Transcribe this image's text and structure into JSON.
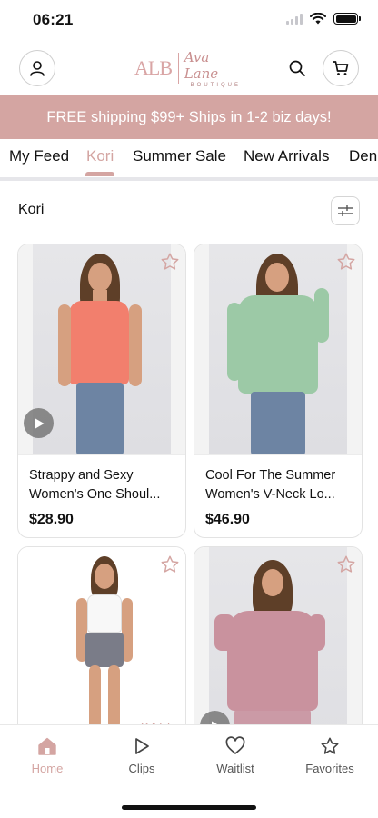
{
  "status_bar": {
    "time": "06:21"
  },
  "header": {
    "logo_monogram": "ALB",
    "logo_script": "Ava Lane",
    "logo_subtitle": "BOUTIQUE"
  },
  "banner": {
    "text": "FREE shipping $99+ Ships in 1-2 biz days!"
  },
  "tabs": [
    {
      "label": "My Feed",
      "active": false
    },
    {
      "label": "Kori",
      "active": true
    },
    {
      "label": "Summer Sale",
      "active": false
    },
    {
      "label": "New Arrivals",
      "active": false
    },
    {
      "label": "Den",
      "active": false
    }
  ],
  "section": {
    "title": "Kori"
  },
  "products": [
    {
      "title_line1": "Strappy and Sexy",
      "title_line2": "Women's One Shoul...",
      "price": "$28.90",
      "top_color": "#f27f6d",
      "has_video": true
    },
    {
      "title_line1": "Cool For The Summer",
      "title_line2": "Women's V-Neck Lo...",
      "price": "$46.90",
      "top_color": "#9cc9a6",
      "has_video": false
    },
    {
      "title_line1": "",
      "title_line2": "",
      "price": "",
      "top_color": "#f8f8f8",
      "has_video": false,
      "badge": "SALE"
    },
    {
      "title_line1": "",
      "title_line2": "",
      "price": "",
      "top_color": "#c9929e",
      "has_video": true
    }
  ],
  "bottom_nav": [
    {
      "label": "Home",
      "icon": "home-icon",
      "active": true
    },
    {
      "label": "Clips",
      "icon": "play-icon",
      "active": false
    },
    {
      "label": "Waitlist",
      "icon": "heart-icon",
      "active": false
    },
    {
      "label": "Favorites",
      "icon": "star-icon",
      "active": false
    }
  ],
  "colors": {
    "brand": "#d4a5a2",
    "text": "#111111"
  }
}
